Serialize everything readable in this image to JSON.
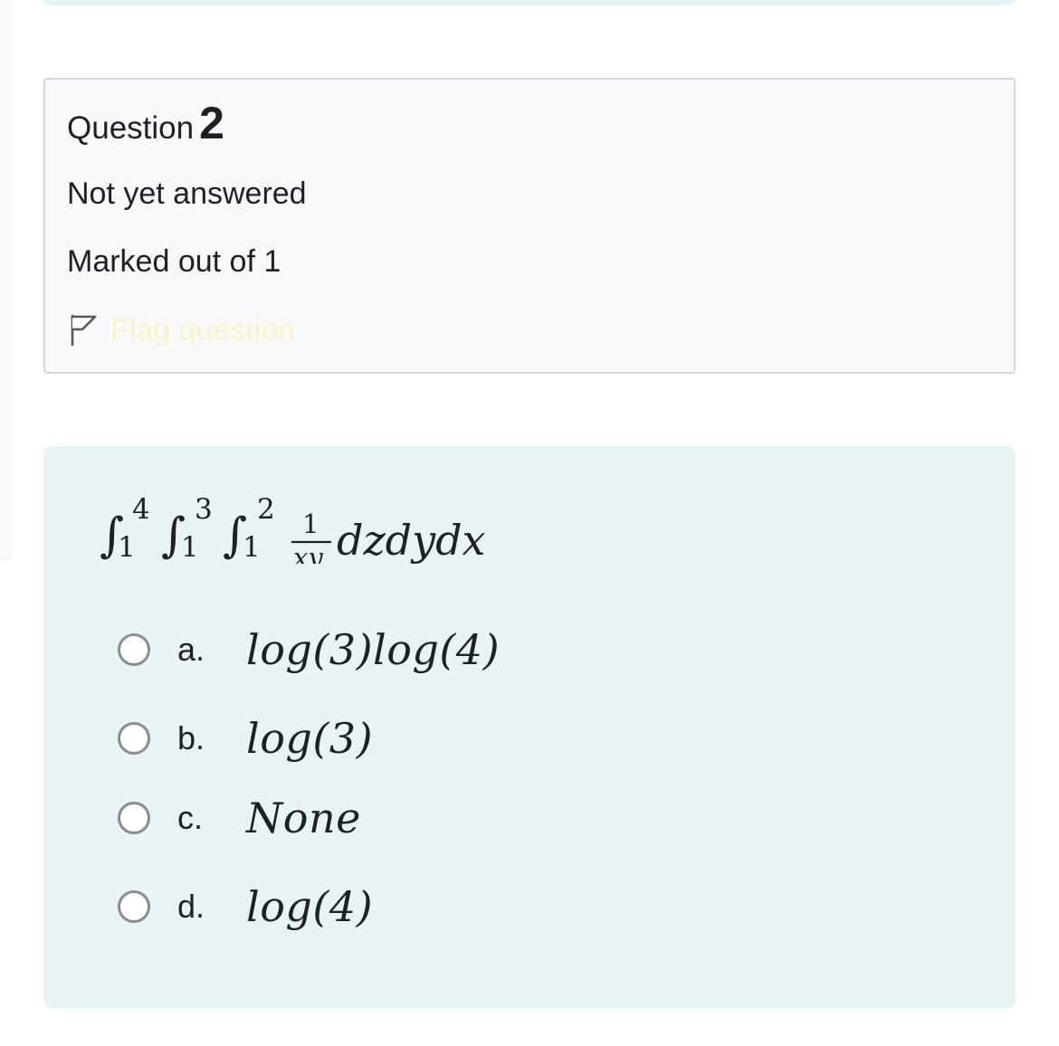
{
  "question": {
    "label": "Question",
    "number": "2",
    "state": "Not yet answered",
    "grade": "Marked out of 1",
    "flag_label": "Flag question"
  },
  "formula": {
    "integral_1_upper": "4",
    "integral_1_lower": "1",
    "integral_2_upper": "3",
    "integral_2_lower": "1",
    "integral_3_upper": "2",
    "integral_3_lower": "1",
    "fraction_numerator": "1",
    "fraction_denominator": "xy",
    "differentials": "dzdydx"
  },
  "options": [
    {
      "letter": "a.",
      "text": "log(3)log(4)"
    },
    {
      "letter": "b.",
      "text": "log(3)"
    },
    {
      "letter": "c.",
      "text": "None"
    },
    {
      "letter": "d.",
      "text": "log(4)"
    }
  ],
  "colors": {
    "info_background": "#f8f9fa",
    "content_background": "#e7f3f5",
    "flag_text": "#fbf3c8",
    "radio_border": "#8a8d90"
  },
  "icons": {
    "flag": "flag-outline-icon"
  }
}
